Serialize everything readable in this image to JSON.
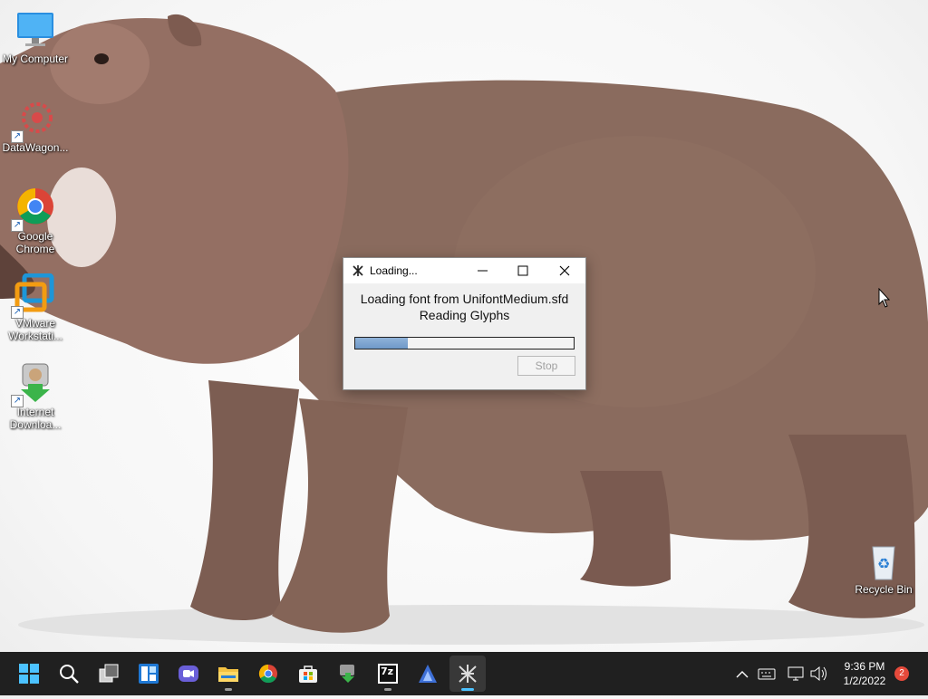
{
  "desktop": {
    "icons": [
      {
        "label": "My Computer"
      },
      {
        "label": "DataWagon..."
      },
      {
        "label": "Google Chrome"
      },
      {
        "label": "VMware Workstati..."
      },
      {
        "label": "Internet Downloa..."
      },
      {
        "label": "Recycle Bin"
      }
    ]
  },
  "dialog": {
    "title": "Loading...",
    "message_line1": "Loading font from UnifontMedium.sfd",
    "message_line2": "Reading Glyphs",
    "progress": 0.24,
    "stop_label": "Stop"
  },
  "taskbar": {
    "apps": [
      "start-icon",
      "search-icon",
      "task-view-icon",
      "widgets-icon",
      "chat-icon",
      "file-explorer-icon",
      "chrome-icon",
      "store-icon",
      "internet-download-manager-icon",
      "7zip-icon",
      "fontforge-accent-icon",
      "fontforge-icon"
    ],
    "seven_zip_label": "7z",
    "clock_time": "9:36 PM",
    "clock_date": "1/2/2022",
    "notification_count": "2"
  },
  "colors": {
    "taskbar": "#202020",
    "accent": "#4cc2ff",
    "progress_fill": "#6f99c8"
  }
}
